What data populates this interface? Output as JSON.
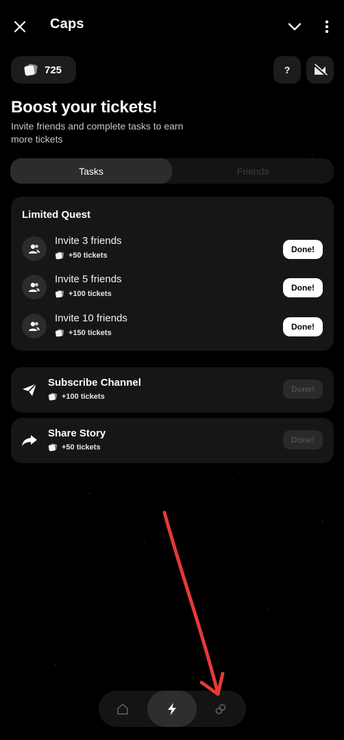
{
  "header": {
    "title": "Caps"
  },
  "balance": {
    "value": "725"
  },
  "help": {
    "label": "?"
  },
  "hero": {
    "headline": "Boost your tickets!",
    "subtext": "Invite friends and complete tasks to earn more tickets"
  },
  "tabs": [
    {
      "label": "Tasks",
      "active": true
    },
    {
      "label": "Friends",
      "active": false
    }
  ],
  "limited_quest": {
    "title": "Limited Quest",
    "items": [
      {
        "title": "Invite 3 friends",
        "reward": "+50 tickets",
        "button": "Done!"
      },
      {
        "title": "Invite 5 friends",
        "reward": "+100 tickets",
        "button": "Done!"
      },
      {
        "title": "Invite 10 friends",
        "reward": "+150 tickets",
        "button": "Done!"
      }
    ]
  },
  "tasks": [
    {
      "title": "Subscribe Channel",
      "reward": "+100 tickets",
      "button": "Done!",
      "icon": "telegram-send-icon"
    },
    {
      "title": "Share Story",
      "reward": "+50 tickets",
      "button": "Done!",
      "icon": "share-arrow-icon"
    }
  ],
  "nav": [
    {
      "name": "home",
      "icon": "home-icon",
      "active": false
    },
    {
      "name": "boost",
      "icon": "lightning-icon",
      "active": true
    },
    {
      "name": "links",
      "icon": "link-icon",
      "active": false
    }
  ],
  "colors": {
    "background": "#000000",
    "card": "#161616",
    "accent_button": "#ffffff",
    "annotation_arrow": "#e53935"
  }
}
